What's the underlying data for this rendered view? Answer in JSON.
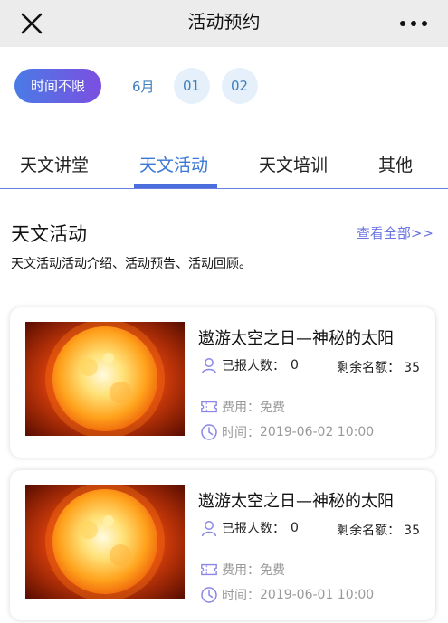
{
  "header": {
    "title": "活动预约",
    "close_icon": "close-icon",
    "more_icon": "more-icon"
  },
  "date_filter": {
    "all_label": "时间不限",
    "month_label": "6月",
    "days": [
      "01",
      "02"
    ]
  },
  "tabs": [
    {
      "label": "天文讲堂",
      "active": false
    },
    {
      "label": "天文活动",
      "active": true
    },
    {
      "label": "天文培训",
      "active": false
    },
    {
      "label": "其他",
      "active": false
    }
  ],
  "section": {
    "title": "天文活动",
    "more_link": "查看全部>>",
    "description": "天文活动活动介绍、活动预告、活动回顾。"
  },
  "activities": [
    {
      "title": "遨游太空之日—神秘的太阳",
      "registered_label": "已报人数：",
      "registered": "0",
      "remaining_label": "剩余名额：",
      "remaining": "35",
      "fee_label": "费用：",
      "fee": "免费",
      "time_label": "时间：",
      "time": "2019-06-02 10:00"
    },
    {
      "title": "遨游太空之日—神秘的太阳",
      "registered_label": "已报人数：",
      "registered": "0",
      "remaining_label": "剩余名额：",
      "remaining": "35",
      "fee_label": "费用：",
      "fee": "免费",
      "time_label": "时间：",
      "time": "2019-06-01 10:00"
    }
  ],
  "colors": {
    "accent_blue": "#3a78d6",
    "gradient_start": "#4a7be6",
    "gradient_end": "#7b4fe0",
    "chip_bg": "#e5f0fb",
    "icon_purple": "#8a86e6"
  }
}
